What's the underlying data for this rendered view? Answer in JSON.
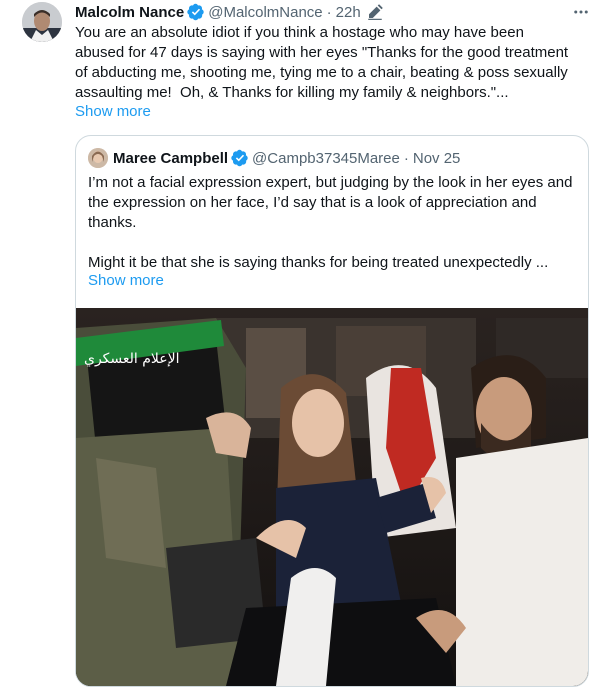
{
  "tweet": {
    "author_name": "Malcolm Nance",
    "handle": "@MalcolmNance",
    "separator": "·",
    "time": "22h",
    "text": "You are an absolute idiot if you think a hostage who may have been abused for 47 days is saying with her eyes \"Thanks for the good treatment of abducting me, shooting me, tying me to a chair, beating & poss sexually assaulting me!  Oh, & Thanks for killing my family & neighbors.\"...",
    "show_more": "Show more",
    "icons": [
      "verified-badge-icon",
      "edit-icon",
      "more-options-icon"
    ]
  },
  "quoted": {
    "author_name": "Maree Campbell",
    "handle": "@Campb37345Maree",
    "separator": "·",
    "date": "Nov 25",
    "text": "I’m not a facial expression expert, but judging by the look in her eyes and the expression on her face, I’d say that is a look of appreciation and thanks.\n\nMight it be that she is saying thanks for being treated unexpectedly ...",
    "show_more": "Show more",
    "media_watermark": "الإعلام العسكري"
  },
  "colors": {
    "accent": "#1d9bf0",
    "muted": "#536471",
    "border": "#cfd9de",
    "hamas_headband": "#1f8a3a"
  }
}
